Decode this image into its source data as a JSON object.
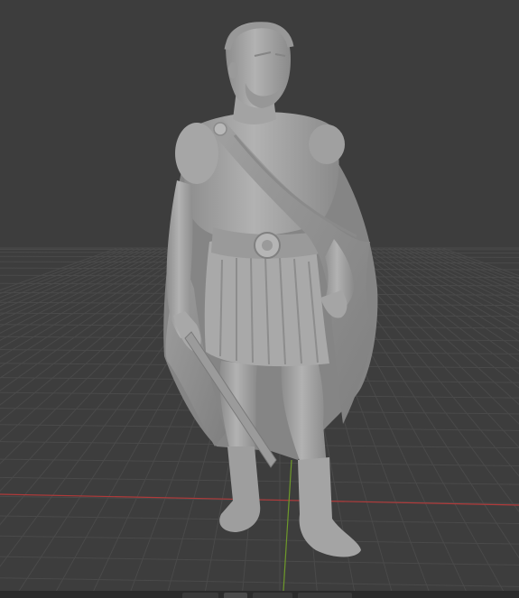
{
  "app": {
    "type": "3d-viewport"
  },
  "viewport": {
    "background_color": "#3d3d3d",
    "grid_color": "#4a4a4a",
    "x_axis_color": "#b03a3a",
    "y_axis_color": "#6e9a2a",
    "model": {
      "subject": "roman-soldier-statue",
      "material_color": "#a8a8a8",
      "shading": "solid"
    }
  },
  "icons": {
    "model": "statue-icon"
  }
}
